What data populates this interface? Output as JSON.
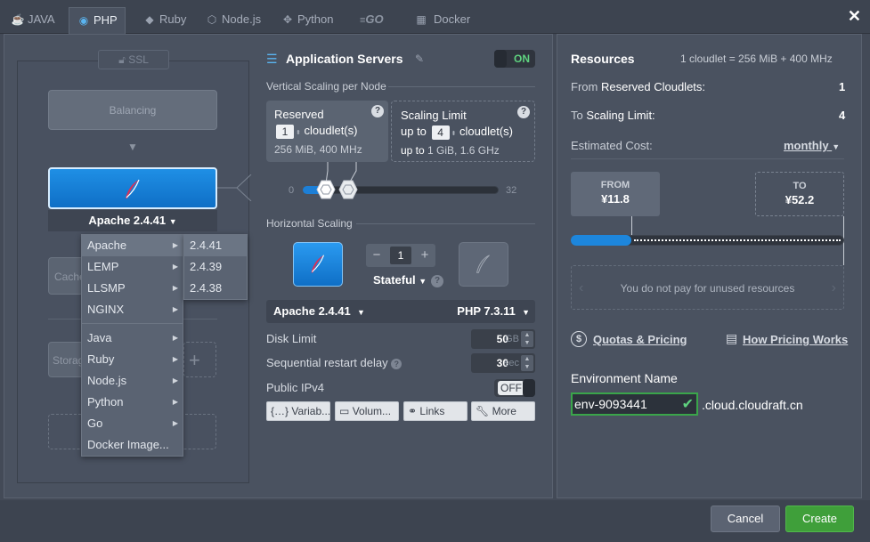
{
  "tabs": [
    {
      "label": "JAVA",
      "icon": "java-icon"
    },
    {
      "label": "PHP",
      "icon": "php-icon"
    },
    {
      "label": "Ruby",
      "icon": "ruby-icon"
    },
    {
      "label": "Node.js",
      "icon": "nodejs-icon"
    },
    {
      "label": "Python",
      "icon": "python-icon"
    },
    {
      "label": "GO",
      "icon": "go-icon"
    },
    {
      "label": "Docker",
      "icon": "docker-icon"
    }
  ],
  "active_tab": "PHP",
  "topology": {
    "ssl_label": "SSL",
    "balancing_label": "Balancing",
    "app_node_label": "Apache 2.4.41",
    "cache_label": "Cache",
    "storage_label": "Storage"
  },
  "stack_menu": {
    "items": [
      "Apache",
      "LEMP",
      "LLSMP",
      "NGINX"
    ],
    "other_items": [
      "Java",
      "Ruby",
      "Node.js",
      "Python",
      "Go",
      "Docker Image..."
    ],
    "highlighted": "Apache",
    "versions": [
      "2.4.41",
      "2.4.39",
      "2.4.38"
    ],
    "selected_version": "2.4.41"
  },
  "app_servers": {
    "title": "Application Servers",
    "toggle": "ON",
    "vertical_scaling_label": "Vertical Scaling per Node",
    "reserved_title": "Reserved",
    "reserved_value": "1",
    "cloudlet_unit": "cloudlet(s)",
    "reserved_sub": "256 MiB, 400 MHz",
    "limit_title": "Scaling Limit",
    "up_to": "up to",
    "limit_value": "4",
    "limit_sub_prefix": "up to",
    "limit_sub": "1 GiB, 1.6 GHz",
    "slider_min": "0",
    "slider_max": "32",
    "horizontal_scaling_label": "Horizontal Scaling",
    "node_count": "1",
    "minus": "−",
    "plus": "+",
    "mode": "Stateful",
    "server_select": "Apache 2.4.41",
    "php_select": "PHP 7.3.11",
    "disk_limit_label": "Disk Limit",
    "disk_limit_value": "50",
    "disk_limit_unit": "GB",
    "restart_delay_label": "Sequential restart delay",
    "restart_delay_value": "30",
    "restart_delay_unit": "sec",
    "ipv4_label": "Public IPv4",
    "ipv4_toggle": "OFF",
    "buttons": [
      "Variab...",
      "Volum...",
      "Links",
      "More"
    ]
  },
  "resources": {
    "title": "Resources",
    "cloudlet_info": "1 cloudlet = 256 MiB + 400 MHz",
    "from_reserved_prefix": "From",
    "from_reserved_label": "Reserved Cloudlets:",
    "from_reserved_value": "1",
    "to_limit_prefix": "To",
    "to_limit_label": "Scaling Limit:",
    "to_limit_value": "4",
    "estimated_cost_label": "Estimated Cost:",
    "period": "monthly",
    "from_label": "FROM",
    "from_cost": "¥11.8",
    "to_label": "TO",
    "to_cost": "¥52.2",
    "reserved_fraction": 0.22,
    "info_text": "You do not pay for unused resources",
    "quotas_link": "Quotas & Pricing",
    "pricing_link": "How Pricing Works",
    "env_name_label": "Environment Name",
    "env_name_value": "env-9093441",
    "env_domain": ".cloud.cloudraft.cn"
  },
  "footer": {
    "cancel": "Cancel",
    "create": "Create"
  },
  "colors": {
    "accent_blue": "#1d7fd6",
    "create_green": "#3f9f3a",
    "on_green": "#5fd27f"
  }
}
